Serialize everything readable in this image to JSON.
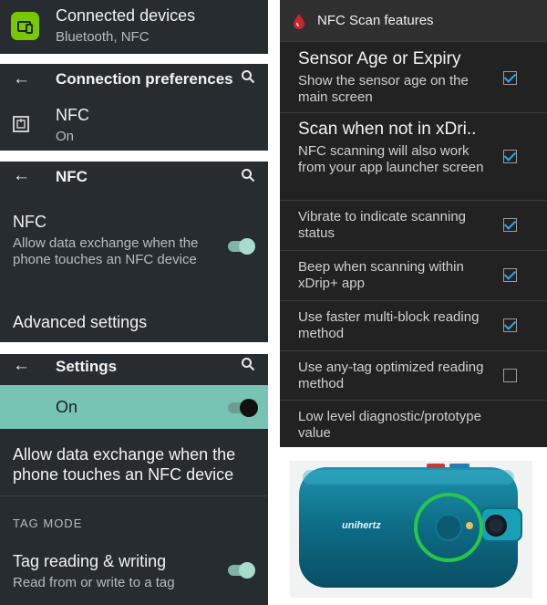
{
  "connected": {
    "title": "Connected devices",
    "subtitle": "Bluetooth, NFC"
  },
  "conn_prefs": {
    "title": "Connection preferences",
    "item_title": "NFC",
    "item_sub": "On"
  },
  "nfc_screen": {
    "title": "NFC",
    "setting_title": "NFC",
    "setting_desc": "Allow data exchange when the phone touches an NFC device",
    "advanced": "Advanced settings"
  },
  "settings_screen": {
    "title": "Settings",
    "on_label": "On",
    "allow_desc": "Allow data exchange when the phone touches an NFC device",
    "section": "TAG MODE",
    "tag_title": "Tag reading & writing",
    "tag_sub": "Read from or write to a tag"
  },
  "nfc_features": {
    "header": "NFC Scan features",
    "items": [
      {
        "title": "Sensor Age or Expiry",
        "desc": "Show the sensor age on the main screen",
        "checked": true
      },
      {
        "title": "Scan when not in xDri..",
        "desc": "NFC scanning will also work from your app launcher screen",
        "checked": true
      },
      {
        "desc": "Vibrate to indicate scanning status",
        "checked": true
      },
      {
        "desc": "Beep when scanning within xDrip+ app",
        "checked": true
      },
      {
        "desc": "Use faster multi-block reading method",
        "checked": true
      },
      {
        "desc": "Use any-tag optimized reading method",
        "checked": false
      },
      {
        "desc": "Low level diagnostic/prototype value",
        "checked": false
      }
    ]
  },
  "phone_photo": {
    "brand": "unihertz"
  },
  "colors": {
    "panel": "#262c30",
    "accent_green": "#78c800",
    "teal_bar": "#78c4b4",
    "checkbox_blue": "#2ea6f0"
  }
}
